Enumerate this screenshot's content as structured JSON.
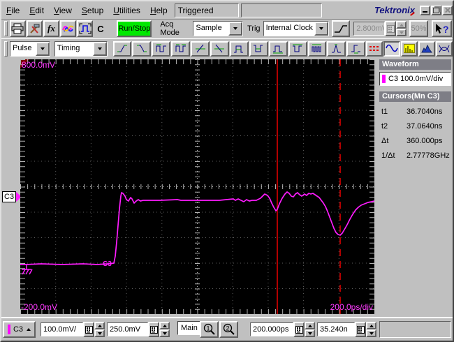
{
  "titlebar": {
    "logo": "Tektronix",
    "status": "Triggered"
  },
  "menu": {
    "items": [
      "File",
      "Edit",
      "View",
      "Setup",
      "Utilities",
      "Help"
    ]
  },
  "toolbar1": {
    "fx_label": "fx",
    "c_label": "C",
    "run_stop": "Run/Stop",
    "acq_mode_label": "Acq Mode",
    "acq_mode_value": "Sample",
    "trig_label": "Trig",
    "trig_source_value": "Internal Clock",
    "trig_level": "2.800mV",
    "trig_pct": "50%"
  },
  "toolbar2": {
    "category_value": "Pulse",
    "subcategory_value": "Timing"
  },
  "plot": {
    "top_scale_label": "800.0mV",
    "bottom_scale_label": "-200.0mV",
    "time_per_div_label": "200.0ps/div",
    "channel_marker": "C3",
    "trace_label": "C3"
  },
  "right_panel": {
    "waveform_header": "Waveform",
    "waveform_item": "C3 100.0mV/div",
    "cursors_header": "Cursors(Mn C3)",
    "readouts": [
      {
        "label": "t1",
        "value": "36.7040ns"
      },
      {
        "label": "t2",
        "value": "37.0640ns"
      },
      {
        "label": "Δt",
        "value": "360.000ps"
      },
      {
        "label": "1/Δt",
        "value": "2.77778GHz"
      }
    ]
  },
  "bottom_bar": {
    "channel": "C3",
    "vertical_scale": "100.0mV/",
    "vertical_offset": "250.0mV",
    "timebase_label": "Main",
    "horizontal_scale": "200.000ps",
    "horizontal_position": "35.240n"
  },
  "icons": {
    "help_q": "?",
    "zoom1": "1",
    "zoom2": "2"
  },
  "colors": {
    "trace": "#ff1cff",
    "cursor": "#ff0000",
    "run_stop_bg": "#00e800",
    "plot_bg": "#000000"
  }
}
